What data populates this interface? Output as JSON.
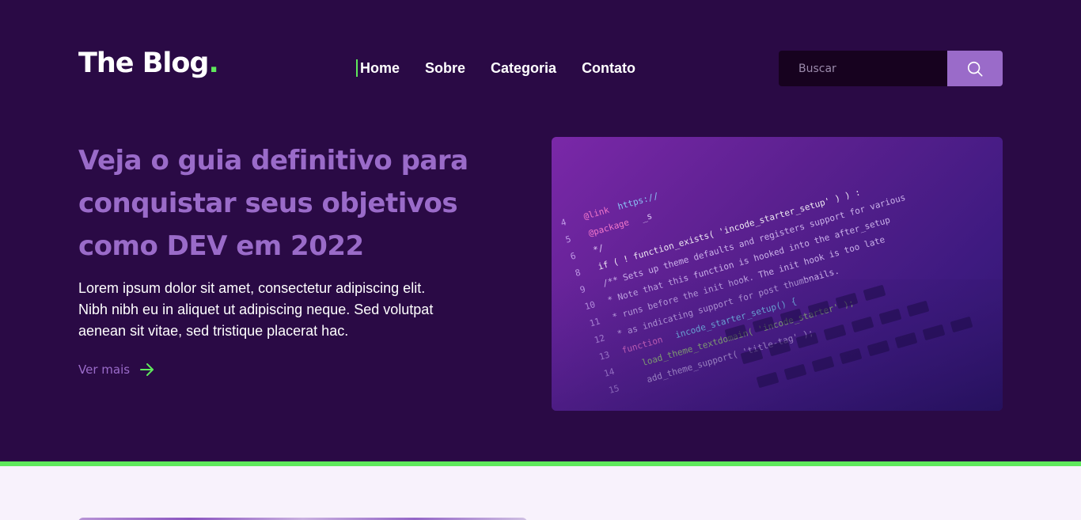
{
  "header": {
    "logo_text": "The Blog",
    "logo_dot": ".",
    "nav": [
      {
        "label": "Home",
        "active": true
      },
      {
        "label": "Sobre",
        "active": false
      },
      {
        "label": "Categoria",
        "active": false
      },
      {
        "label": "Contato",
        "active": false
      }
    ],
    "search": {
      "placeholder": "Buscar",
      "value": "",
      "icon": "search-icon"
    }
  },
  "hero": {
    "title": "Veja o guia definitivo para conquistar seus objetivos como DEV em 2022",
    "text": "Lorem ipsum dolor sit amet, consectetur adipiscing elit. Nibh nibh eu in aliquet ut adipiscing neque. Sed volutpat aenean sit vitae, sed tristique placerat hac.",
    "link_label": "Ver mais",
    "link_icon": "arrow-right-icon",
    "image_alt": "code-editor-laptop-image"
  },
  "colors": {
    "background": "#2a0a45",
    "accent_purple": "#9a6bc9",
    "accent_green": "#5fe85c",
    "search_bg": "#17021f",
    "lower_bg": "#f8f2fc"
  }
}
